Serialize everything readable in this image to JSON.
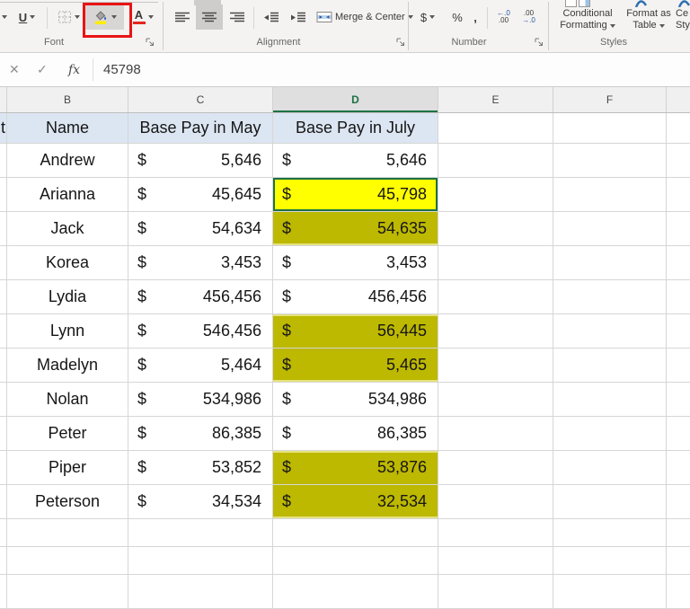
{
  "ribbon": {
    "groups": {
      "font": {
        "label": "Font",
        "underline": "U",
        "font_color": "A"
      },
      "alignment": {
        "label": "Alignment",
        "merge_center": "Merge & Center"
      },
      "number": {
        "label": "Number",
        "dollar": "$",
        "percent": "%",
        "comma": ",",
        "increase_decimal_top": "←.0",
        "increase_decimal_bottom": ".00",
        "decrease_decimal_top": ".00",
        "decrease_decimal_bottom": "→.0"
      },
      "styles": {
        "label": "Styles",
        "conditional_1": "Conditional",
        "conditional_2": "Formatting",
        "format_table_1": "Format as",
        "format_table_2": "Table",
        "cell_styles_1": "Ce",
        "cell_styles_2": "Style"
      }
    }
  },
  "formula_bar": {
    "cancel": "✕",
    "enter": "✓",
    "fx": "fx",
    "value": "45798"
  },
  "grid": {
    "currency": "$",
    "column_letters": [
      "B",
      "C",
      "D",
      "E",
      "F"
    ],
    "selected_column": "D",
    "column_a_partial_text": "t",
    "headers": {
      "name": "Name",
      "may": "Base Pay in May",
      "july": "Base Pay in July"
    },
    "rows": [
      {
        "name": "Andrew",
        "may": "5,646",
        "july": "5,646",
        "highlight": "none"
      },
      {
        "name": "Arianna",
        "may": "45,645",
        "july": "45,798",
        "highlight": "active"
      },
      {
        "name": "Jack",
        "may": "54,634",
        "july": "54,635",
        "highlight": "selected"
      },
      {
        "name": "Korea",
        "may": "3,453",
        "july": "3,453",
        "highlight": "none"
      },
      {
        "name": "Lydia",
        "may": "456,456",
        "july": "456,456",
        "highlight": "none"
      },
      {
        "name": "Lynn",
        "may": "546,456",
        "july": "56,445",
        "highlight": "selected"
      },
      {
        "name": "Madelyn",
        "may": "5,464",
        "july": "5,465",
        "highlight": "selected"
      },
      {
        "name": "Nolan",
        "may": "534,986",
        "july": "534,986",
        "highlight": "none"
      },
      {
        "name": "Peter",
        "may": "86,385",
        "july": "86,385",
        "highlight": "none"
      },
      {
        "name": "Piper",
        "may": "53,852",
        "july": "53,876",
        "highlight": "selected"
      },
      {
        "name": "Peterson",
        "may": "34,534",
        "july": "32,534",
        "highlight": "selected"
      }
    ]
  },
  "colors": {
    "highlight_yellow": "#FFFF00",
    "highlight_selected_olive": "#BDB800",
    "selection_green": "#1E7145",
    "header_fill_blue": "#DCE6F2",
    "annotation_red": "#E81414"
  }
}
